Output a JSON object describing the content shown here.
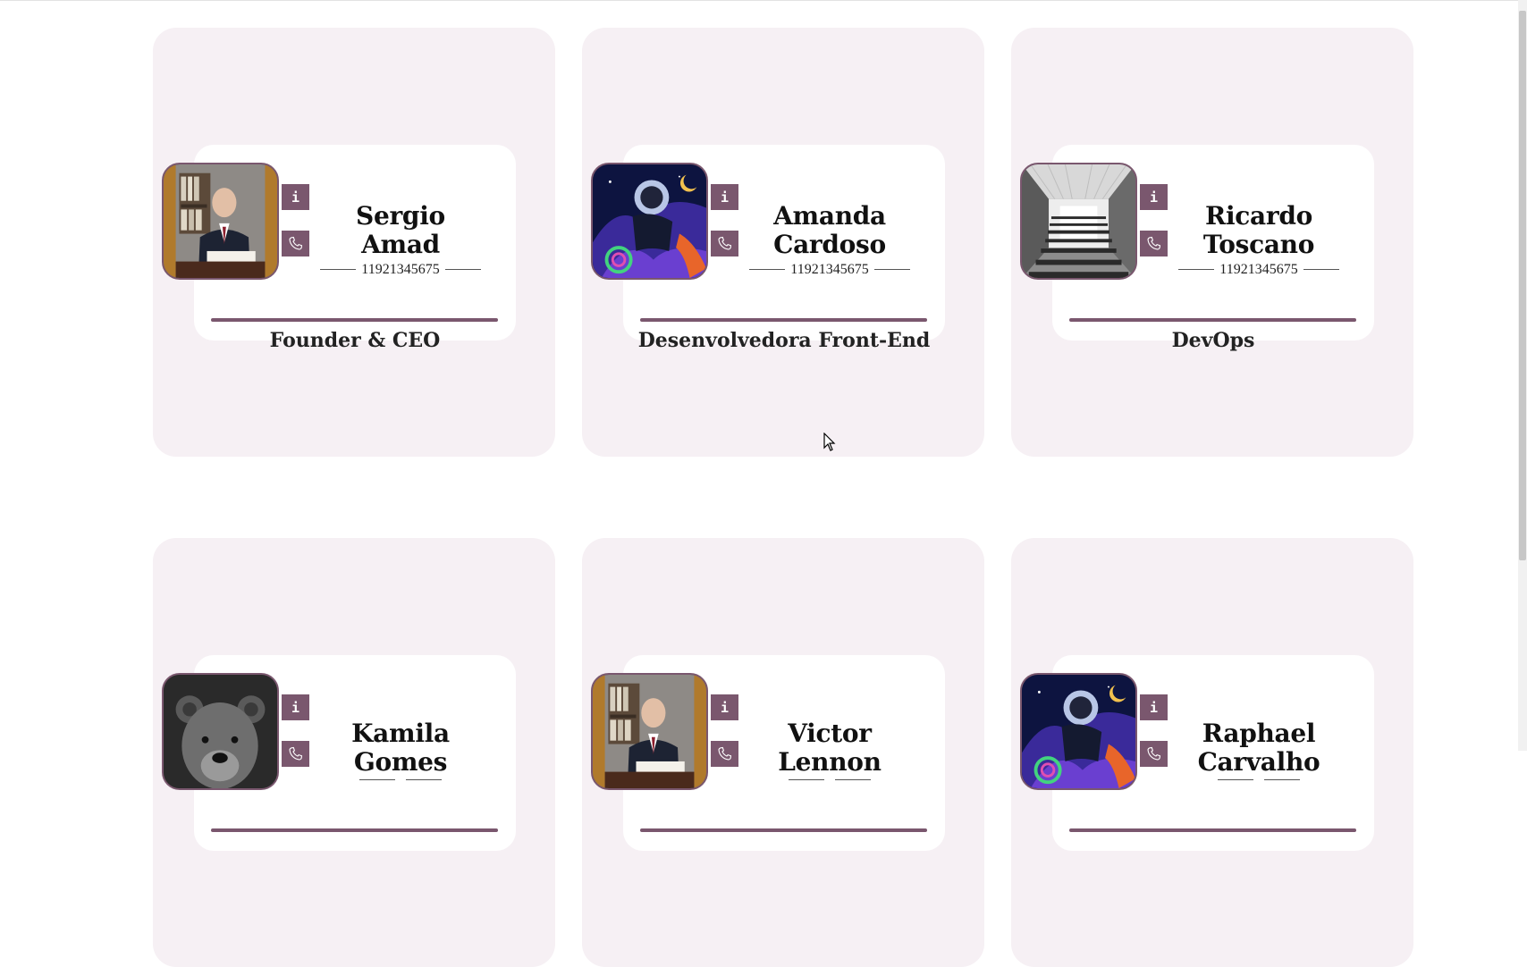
{
  "cards": [
    {
      "name": "Sergio Amad",
      "phone": "11921345675",
      "role": "Founder & CEO",
      "photo": "portrait-man-reading",
      "info_label": "i"
    },
    {
      "name": "Amanda Cardoso",
      "phone": "11921345675",
      "role": "Desenvolvedora Front-End",
      "photo": "space-astronaut-art",
      "info_label": "i"
    },
    {
      "name": "Ricardo Toscano",
      "phone": "11921345675",
      "role": "DevOps",
      "photo": "tunnel-staircase",
      "info_label": "i"
    },
    {
      "name": "Kamila Gomes",
      "phone": "",
      "role": "",
      "photo": "bear-portrait",
      "info_label": "i"
    },
    {
      "name": "Victor Lennon",
      "phone": "",
      "role": "",
      "photo": "portrait-man-reading",
      "info_label": "i"
    },
    {
      "name": "Raphael Carvalho",
      "phone": "",
      "role": "",
      "photo": "space-astronaut-art",
      "info_label": "i"
    }
  ],
  "theme": {
    "accent": "#7a576e",
    "card_bg": "#f6f0f4",
    "inner_bg": "#ffffff"
  }
}
